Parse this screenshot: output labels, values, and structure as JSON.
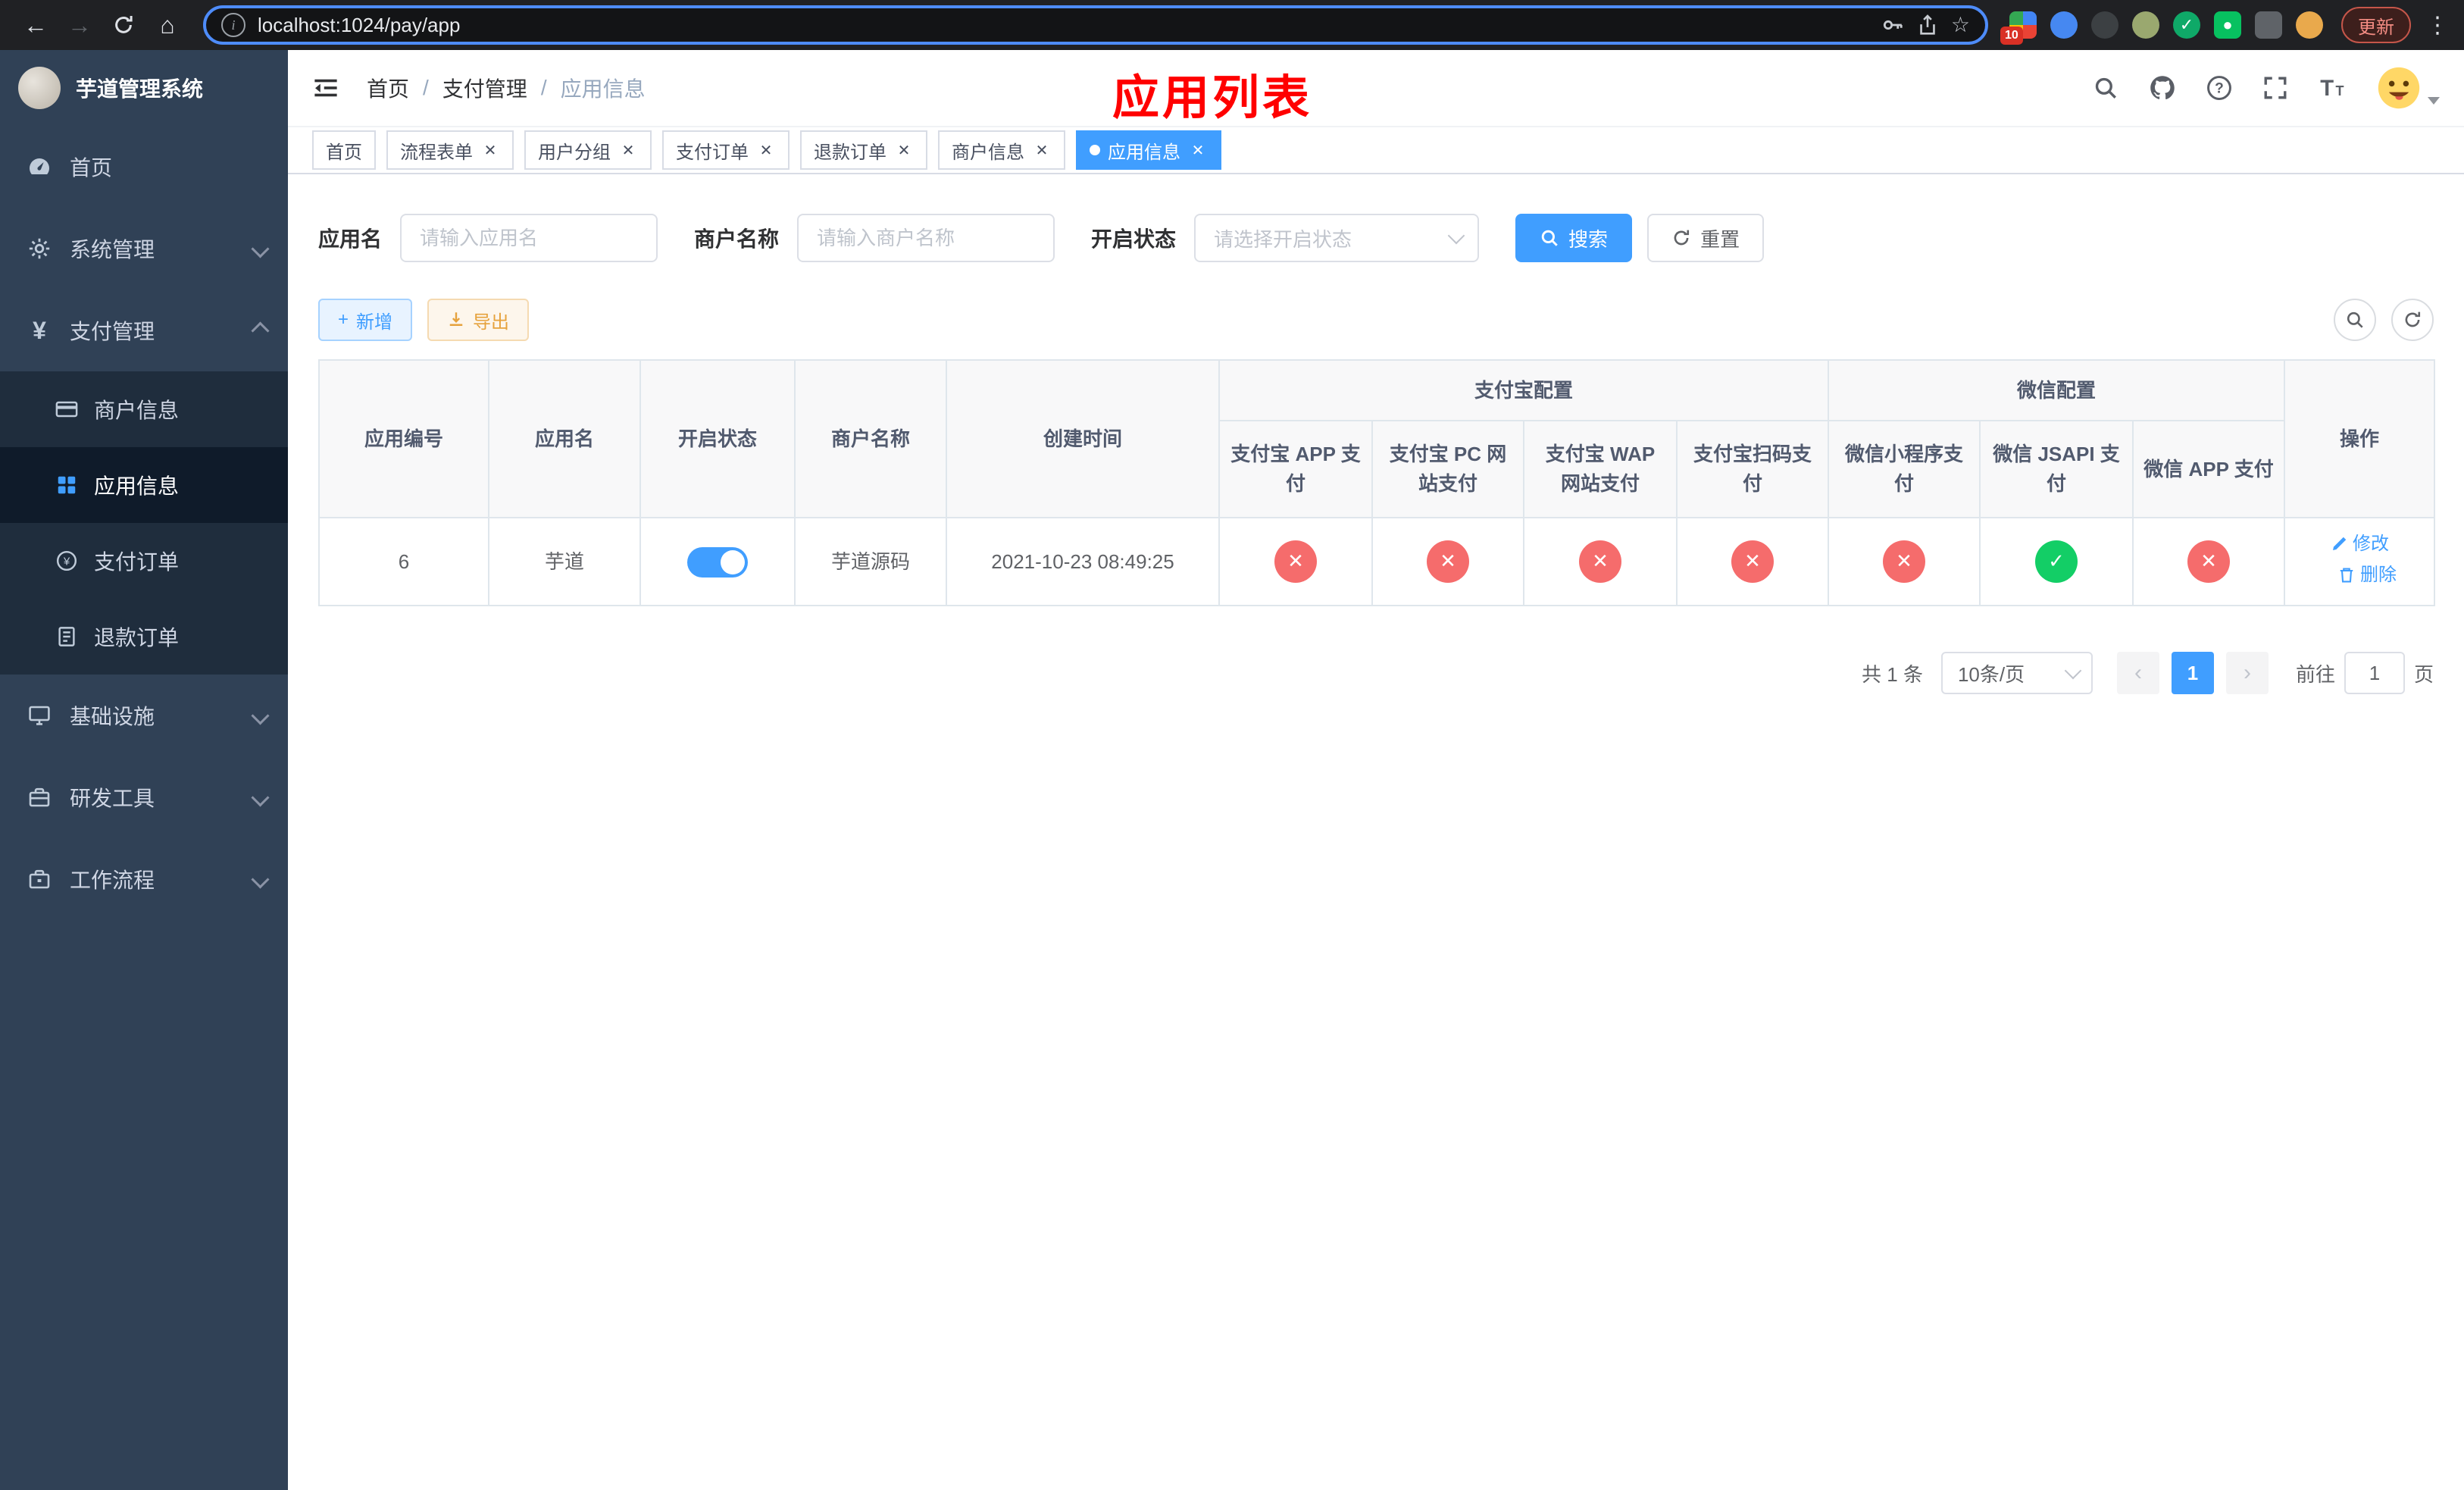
{
  "browser": {
    "url": "localhost:1024/pay/app",
    "update_label": "更新",
    "ext_badge": "10"
  },
  "sidebar": {
    "title": "芋道管理系统",
    "items": [
      {
        "label": "首页"
      },
      {
        "label": "系统管理"
      },
      {
        "label": "支付管理"
      },
      {
        "label": "基础设施"
      },
      {
        "label": "研发工具"
      },
      {
        "label": "工作流程"
      }
    ],
    "payment_children": [
      {
        "label": "商户信息"
      },
      {
        "label": "应用信息"
      },
      {
        "label": "支付订单"
      },
      {
        "label": "退款订单"
      }
    ]
  },
  "header": {
    "breadcrumb": {
      "home": "首页",
      "section": "支付管理",
      "current": "应用信息",
      "separator": "/"
    },
    "page_title": "应用列表"
  },
  "tabs": {
    "items": [
      {
        "label": "首页"
      },
      {
        "label": "流程表单"
      },
      {
        "label": "用户分组"
      },
      {
        "label": "支付订单"
      },
      {
        "label": "退款订单"
      },
      {
        "label": "商户信息"
      },
      {
        "label": "应用信息"
      }
    ]
  },
  "filters": {
    "app_name_label": "应用名",
    "app_name_placeholder": "请输入应用名",
    "merchant_label": "商户名称",
    "merchant_placeholder": "请输入商户名称",
    "status_label": "开启状态",
    "status_placeholder": "请选择开启状态",
    "search_label": "搜索",
    "reset_label": "重置"
  },
  "toolbar": {
    "add_label": "新增",
    "export_label": "导出"
  },
  "table": {
    "groups": {
      "alipay": "支付宝配置",
      "wechat": "微信配置"
    },
    "columns": {
      "id": "应用编号",
      "name": "应用名",
      "status": "开启状态",
      "merchant": "商户名称",
      "created": "创建时间",
      "alipay_app": "支付宝 APP 支付",
      "alipay_pc": "支付宝 PC 网站支付",
      "alipay_wap": "支付宝 WAP 网站支付",
      "alipay_qr": "支付宝扫码支付",
      "wx_mini": "微信小程序支付",
      "wx_jsapi": "微信 JSAPI 支付",
      "wx_app": "微信 APP 支付",
      "actions": "操作"
    },
    "rows": [
      {
        "id": "6",
        "name": "芋道",
        "enabled": "true",
        "merchant": "芋道源码",
        "created": "2021-10-23 08:49:25",
        "configs": [
          "false",
          "false",
          "false",
          "false",
          "false",
          "true",
          "false"
        ],
        "edit_label": "修改",
        "delete_label": "删除"
      }
    ]
  },
  "pagination": {
    "total": "共 1 条",
    "size": "10条/页",
    "page": "1",
    "goto_prefix": "前往",
    "goto_value": "1",
    "goto_suffix": "页"
  },
  "colors": {
    "primary": "#409eff",
    "danger": "#f56c6c",
    "success": "#13ce66",
    "warning": "#e6a23c",
    "title_red": "#ff0000"
  }
}
